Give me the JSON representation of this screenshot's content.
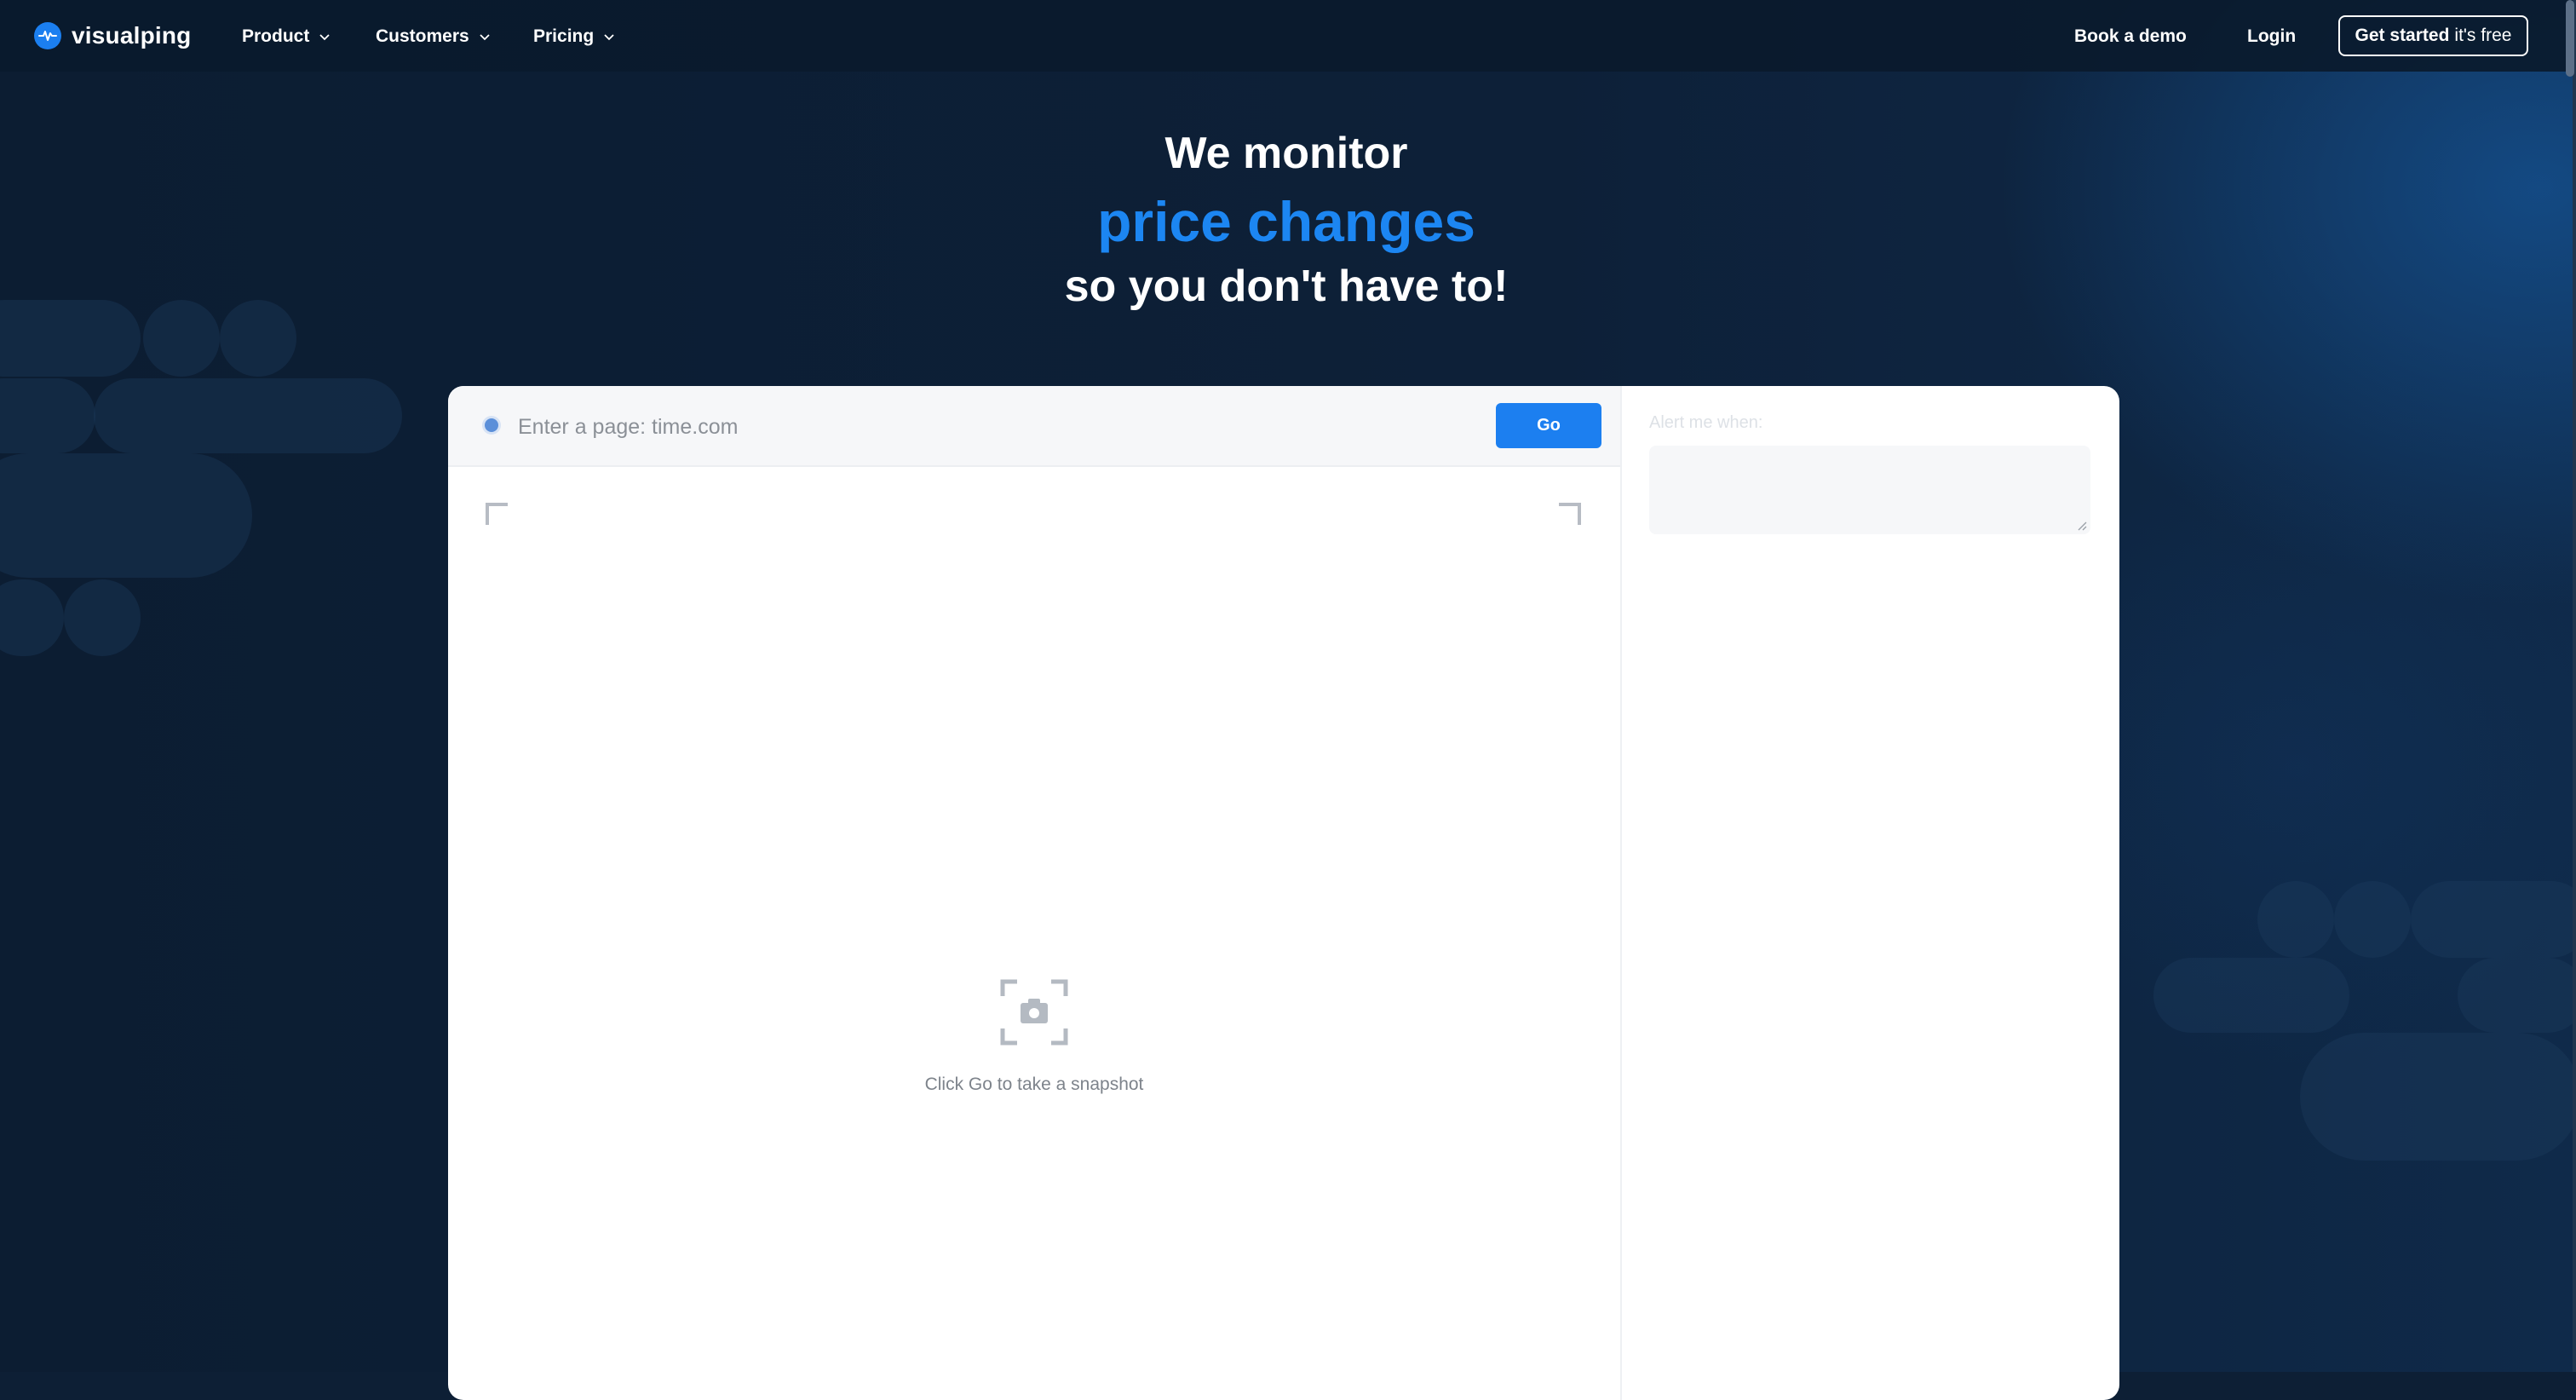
{
  "nav": {
    "logo_text": "visualping",
    "items": [
      {
        "label": "Product"
      },
      {
        "label": "Customers"
      },
      {
        "label": "Pricing"
      }
    ],
    "book_demo": "Book a demo",
    "login": "Login",
    "cta_bold": "Get started",
    "cta_light": "it's free"
  },
  "hero": {
    "line1": "We monitor",
    "line2": "price changes",
    "line3": "so you don't have to!"
  },
  "card": {
    "url_placeholder": "Enter a page: time.com",
    "go_label": "Go",
    "snapshot_hint": "Click Go to take a snapshot",
    "alert_label": "Alert me when:"
  },
  "colors": {
    "accent": "#1c86f2",
    "background": "#0d1f35",
    "go_button": "#1c7ff0"
  },
  "icons": [
    "logo-icon",
    "chevron-down-icon",
    "camera-icon",
    "resize-grip-icon"
  ]
}
